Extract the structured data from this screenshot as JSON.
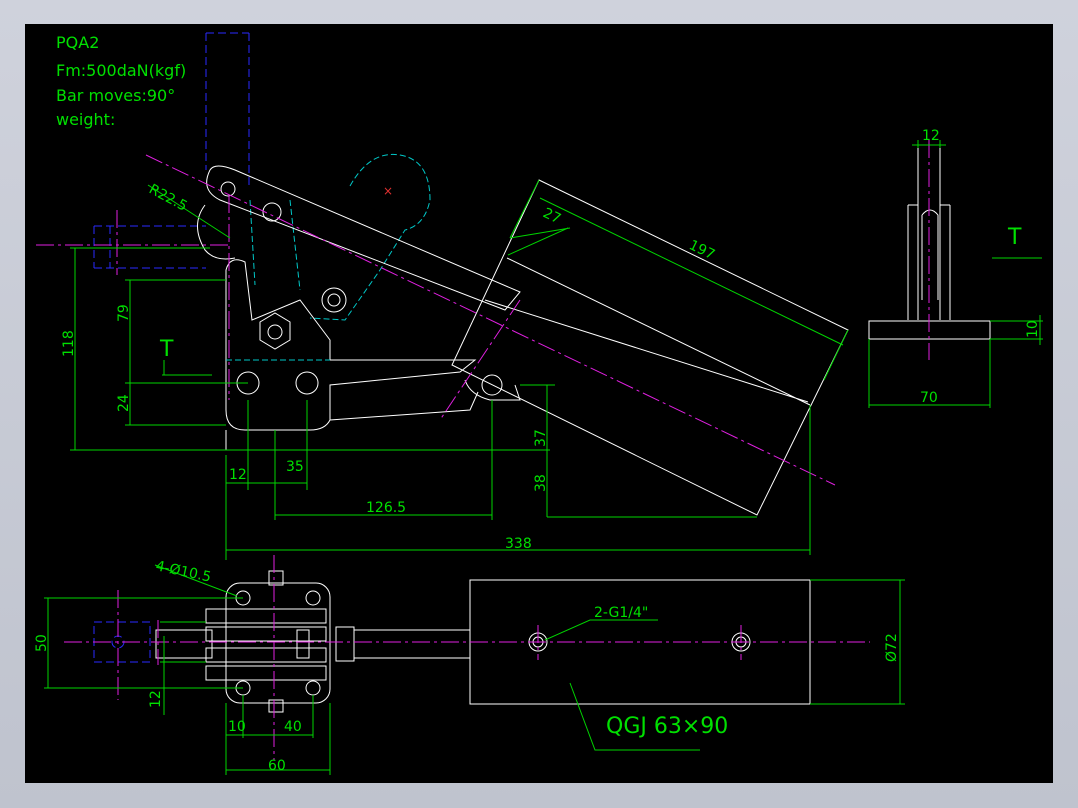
{
  "notes": {
    "model": "PQA2",
    "force": "Fm:500daN(kgf)",
    "bar_moves": "Bar moves:90°",
    "weight": "weight:"
  },
  "front_view": {
    "radius": "R22.5",
    "dim_27": "27",
    "dim_197": "197",
    "dim_79": "79",
    "dim_118": "118",
    "dim_24": "24",
    "dim_12": "12",
    "dim_35": "35",
    "dim_126_5": "126.5",
    "dim_37": "37",
    "dim_38": "38",
    "dim_338": "338",
    "section_mark_left": "T"
  },
  "side_view": {
    "dim_12": "12",
    "dim_10": "10",
    "dim_70": "70",
    "section_mark": "T"
  },
  "top_view": {
    "holes": "4-Ø10.5",
    "dim_50": "50",
    "dim_12": "12",
    "dim_10": "10",
    "dim_40": "40",
    "dim_60": "60",
    "ports": "2-G1/4\"",
    "dia_72": "Ø72",
    "cylinder": "QGJ 63×90"
  },
  "colors": {
    "background": "#000000",
    "outline": "#ffffff",
    "dimension": "#00d400",
    "centerline": "#e020e0",
    "hidden": "#00c8c8",
    "phantom": "#2a2aff"
  }
}
